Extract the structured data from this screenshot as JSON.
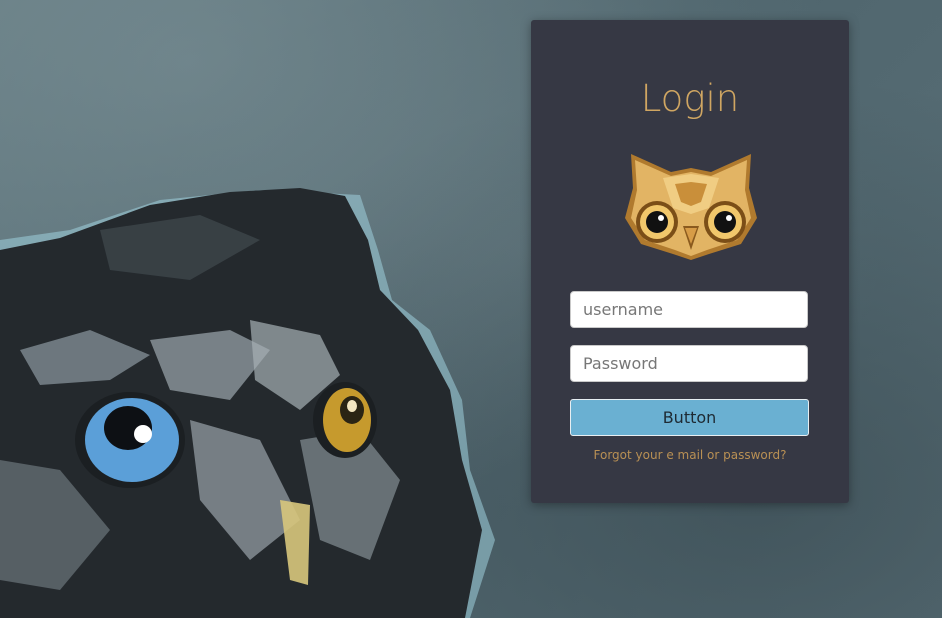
{
  "login": {
    "title": "Login",
    "username_placeholder": "username",
    "password_placeholder": "Password",
    "button_label": "Button",
    "forgot_link": "Forgot your e mail or password?"
  },
  "icons": {
    "logo": "owl-icon",
    "background": "owl-illustration"
  },
  "colors": {
    "title": "#d0a662",
    "button": "#6ab0d2",
    "link": "#b99054",
    "card": "#363844"
  }
}
